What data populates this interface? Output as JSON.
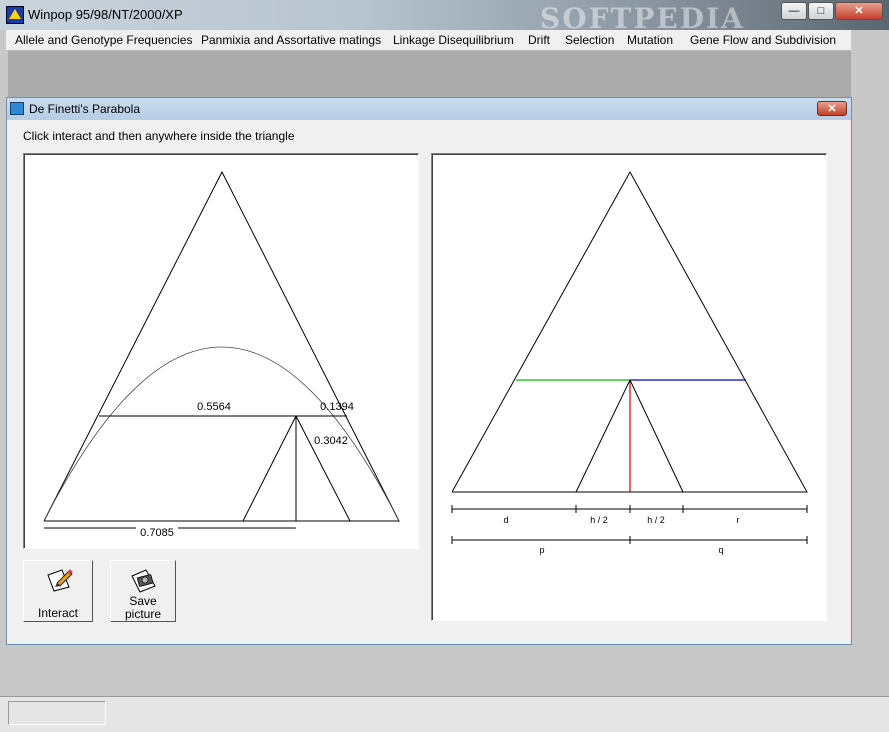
{
  "window": {
    "title": "Winpop 95/98/NT/2000/XP",
    "watermark": "SOFTPEDIA"
  },
  "window_controls": {
    "minimize": "—",
    "maximize": "□",
    "close": "✕"
  },
  "menu": [
    "Allele and Genotype Frequencies",
    "Panmixia and Assortative matings",
    "Linkage Disequilibrium",
    "Drift",
    "Selection",
    "Mutation",
    "Gene Flow and Subdivision"
  ],
  "child": {
    "title": "De Finetti's Parabola",
    "close": "✕",
    "instruction": "Click interact and then anywhere inside the triangle"
  },
  "left_plot": {
    "value_a": "0.5564",
    "value_b": "0.1394",
    "value_c": "0.3042",
    "value_d": "0.7085"
  },
  "right_plot": {
    "label_d": "d",
    "label_h1": "h / 2",
    "label_h2": "h / 2",
    "label_r": "r",
    "label_p": "p",
    "label_q": "q"
  },
  "colors": {
    "green_line": "#00c000",
    "blue_line": "#0000d0",
    "red_line": "#d00000"
  },
  "buttons": {
    "interact": "Interact",
    "save_line1": "Save",
    "save_line2": "picture"
  },
  "icons": {
    "interact": "pencil-paper-icon",
    "save": "camera-paper-icon"
  }
}
